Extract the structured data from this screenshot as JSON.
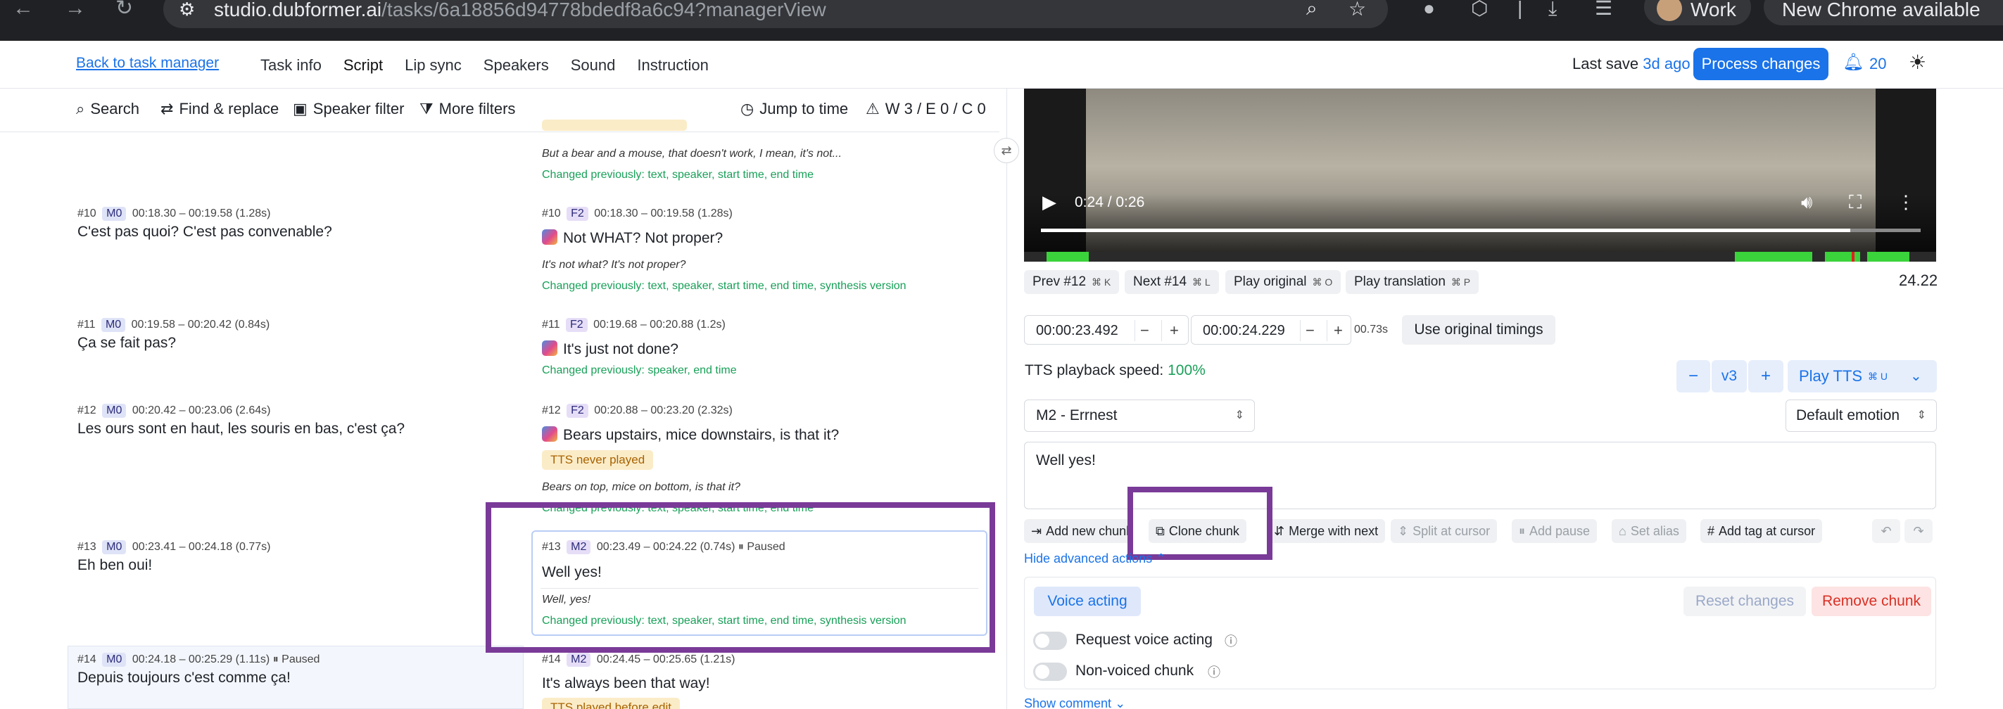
{
  "browser": {
    "url_domain": "studio.dubformer.ai",
    "url_path": "/tasks/6a18856d94778bdedf8a6c94?managerView",
    "profile_label": "Work",
    "update_label": "New Chrome available"
  },
  "header": {
    "back_link": "Back to task manager",
    "tabs": [
      "Task info",
      "Script",
      "Lip sync",
      "Speakers",
      "Sound",
      "Instruction"
    ],
    "active_tab": "Script",
    "last_save_label": "Last save",
    "last_save_ago": "3d ago",
    "process_button": "Process changes",
    "notification_count": "20"
  },
  "filters": {
    "search": "Search",
    "find_replace": "Find & replace",
    "speaker_filter": "Speaker filter",
    "more_filters": "More filters",
    "jump_to_time": "Jump to time",
    "stats": "W 3 / E 0 / C 0"
  },
  "rows": [
    {
      "literal": "But a bear and a mouse, that doesn't work, I mean, it's not...",
      "changed": "Changed previously: text, speaker, start time, end time"
    },
    {
      "orig": {
        "num": "#10",
        "speaker": "M0",
        "time": "00:18.30 – 00:19.58 (1.28s)",
        "text": "C'est pas quoi? C'est pas convenable?"
      },
      "tr": {
        "num": "#10",
        "speaker": "F2",
        "time": "00:18.30 – 00:19.58 (1.28s)",
        "text": "Not WHAT? Not proper?"
      },
      "literal": "It's not what? It's not proper?",
      "changed": "Changed previously: text, speaker, start time, end time, synthesis version"
    },
    {
      "orig": {
        "num": "#11",
        "speaker": "M0",
        "time": "00:19.58 – 00:20.42 (0.84s)",
        "text": "Ça se fait pas?"
      },
      "tr": {
        "num": "#11",
        "speaker": "F2",
        "time": "00:19.68 – 00:20.88 (1.2s)",
        "text": "It's just not done?"
      },
      "changed": "Changed previously: speaker, end time"
    },
    {
      "orig": {
        "num": "#12",
        "speaker": "M0",
        "time": "00:20.42 – 00:23.06 (2.64s)",
        "text": "Les ours sont en haut, les souris en bas, c'est ça?"
      },
      "tr": {
        "num": "#12",
        "speaker": "F2",
        "time": "00:20.88 – 00:23.20 (2.32s)",
        "text": "Bears upstairs, mice downstairs, is that it?"
      },
      "tag": "TTS never played",
      "literal": "Bears on top, mice on bottom, is that it?",
      "changed": "Changed previously: text, speaker, start time, end time"
    },
    {
      "orig": {
        "num": "#13",
        "speaker": "M0",
        "time": "00:23.41 – 00:24.18 (0.77s)",
        "text": "Eh ben oui!"
      },
      "tr": {
        "num": "#13",
        "speaker": "M2",
        "time": "00:23.49 – 00:24.22 (0.74s)",
        "status": "Paused",
        "text": "Well yes!"
      },
      "literal": "Well, yes!",
      "changed": "Changed previously: text, speaker, start time, end time, synthesis version"
    },
    {
      "orig": {
        "num": "#14",
        "speaker": "M0",
        "time": "00:24.18 – 00:25.29 (1.11s)",
        "status": "Paused",
        "text": "Depuis toujours c'est comme ça!"
      },
      "tr": {
        "num": "#14",
        "speaker": "M2",
        "time": "00:24.45 – 00:25.65 (1.21s)",
        "text": "It's always been that way!"
      },
      "tag": "TTS played before edit"
    }
  ],
  "player": {
    "time": "0:24 / 0:26",
    "progress": 0.92,
    "position": "24.22"
  },
  "navigation": {
    "prev": "Prev #12",
    "prev_key": "⌘ K",
    "next": "Next #14",
    "next_key": "⌘ L",
    "play_original": "Play original",
    "play_original_key": "⌘ O",
    "play_translation": "Play translation",
    "play_translation_key": "⌘ P"
  },
  "timing": {
    "start": "00:00:23.492",
    "end": "00:00:24.229",
    "duration": "00.73s",
    "use_original": "Use original timings"
  },
  "tts": {
    "speed_label": "TTS playback speed:",
    "speed_value": "100%",
    "version": "v3",
    "play_label": "Play TTS",
    "play_key": "⌘ U"
  },
  "speaker_select": "M2 - Errnest",
  "emotion_select": "Default emotion",
  "chunk_text": "Well yes!",
  "actions": {
    "add_chunk": "Add new chunk",
    "clone_chunk": "Clone chunk",
    "merge": "Merge with next",
    "split": "Split at cursor",
    "add_pause": "Add pause",
    "set_alias": "Set alias",
    "add_tag": "Add tag at cursor"
  },
  "advanced": {
    "hide_label": "Hide advanced actions",
    "voice_acting_tab": "Voice acting",
    "reset": "Reset changes",
    "remove": "Remove chunk",
    "request_voice_acting": "Request voice acting",
    "non_voiced": "Non-voiced chunk",
    "show_comment": "Show comment"
  },
  "colors": {
    "accent": "#1a73e8",
    "changed_green": "#18a058",
    "highlight_purple": "#7a3b98"
  }
}
